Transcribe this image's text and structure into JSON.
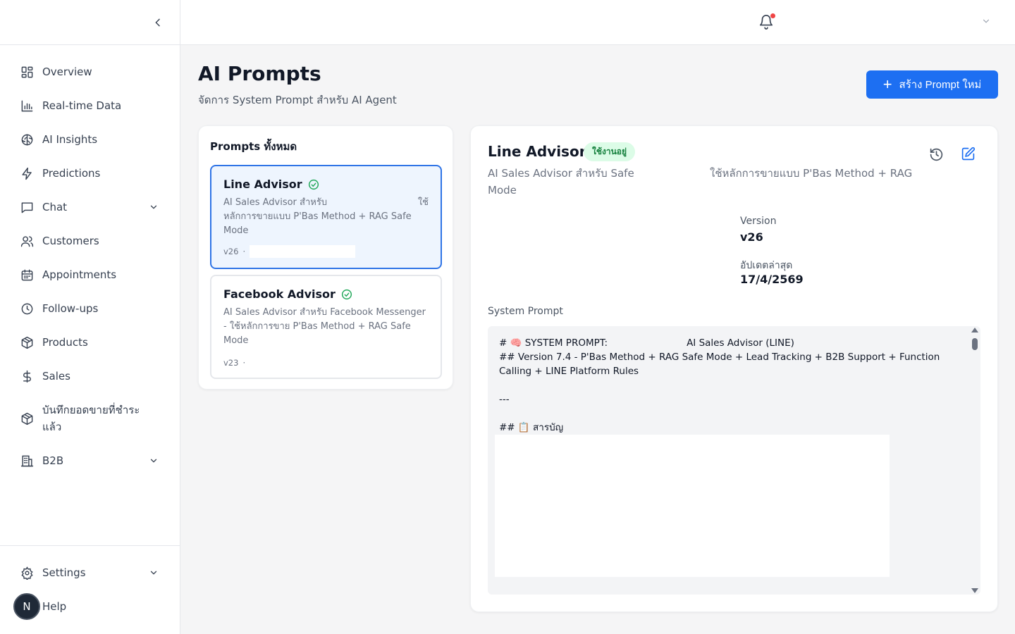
{
  "sidebar": {
    "items": [
      {
        "label": "Overview"
      },
      {
        "label": "Real-time Data"
      },
      {
        "label": "AI Insights"
      },
      {
        "label": "Predictions"
      },
      {
        "label": "Chat"
      },
      {
        "label": "Customers"
      },
      {
        "label": "Appointments"
      },
      {
        "label": "Follow-ups"
      },
      {
        "label": "Products"
      },
      {
        "label": "Sales"
      },
      {
        "label": "บันทึกยอดขายที่ชำระแล้ว"
      },
      {
        "label": "B2B"
      }
    ],
    "bottom": [
      {
        "label": "Settings"
      },
      {
        "label": "Help"
      }
    ],
    "avatar_letter": "N"
  },
  "page": {
    "title": "AI Prompts",
    "subtitle": "จัดการ System Prompt สำหรับ AI Agent",
    "create_button": "สร้าง Prompt ใหม่"
  },
  "prompts": {
    "title": "Prompts ทั้งหมด",
    "items": [
      {
        "name": "Line Advisor",
        "desc_a": "AI Sales Advisor สำหรับ",
        "desc_b": "ใช้",
        "desc_c": "หลักการขายแบบ P'Bas Method + RAG Safe Mode",
        "version": "v26"
      },
      {
        "name": "Facebook Advisor",
        "desc": "AI Sales Advisor สำหรับ Facebook Messenger - ใช้หลักการขาย P'Bas Method + RAG Safe Mode",
        "version": "v23"
      }
    ]
  },
  "detail": {
    "name": "Line Advisor",
    "status": "ใช้งานอยู่",
    "desc_left": "AI Sales Advisor สำหรับ Safe Mode",
    "desc_right": "ใช้หลักการขายแบบ P'Bas Method + RAG",
    "version_label": "Version",
    "version_value": "v26",
    "updated_label": "อัปเดตล่าสุด",
    "updated_value": "17/4/2569",
    "system_prompt_label": "System Prompt",
    "sp_line1a": "# 🧠 SYSTEM PROMPT:",
    "sp_line1b": "AI Sales Advisor (LINE)",
    "sp_line2": "## Version 7.4 - P'Bas Method + RAG Safe Mode + Lead Tracking + B2B Support + Function Calling + LINE Platform Rules",
    "sp_line3": "---",
    "sp_line4": "## 📋 สารบัญ"
  },
  "colors": {
    "primary": "#1d6ff2",
    "active_border": "#2f74e6",
    "active_bg": "#eef5fe",
    "badge_bg": "#dcfce7",
    "badge_text": "#15803d",
    "check": "#22a85a",
    "notification_dot": "#ef4444"
  }
}
